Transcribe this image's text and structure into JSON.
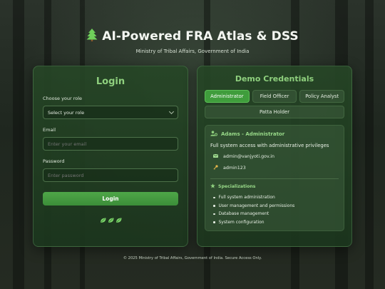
{
  "header": {
    "title": "AI-Powered FRA Atlas & DSS",
    "subtitle": "Ministry of Tribal Affairs, Government of India",
    "logo_icon": "tree-icon"
  },
  "login": {
    "title": "Login",
    "role_label": "Choose your role",
    "role_selected": "Select your role",
    "email_label": "Email",
    "email_placeholder": "Enter your email",
    "password_label": "Password",
    "password_placeholder": "Enter password",
    "submit_label": "Login"
  },
  "demo": {
    "title": "Demo Credentials",
    "roles": [
      {
        "label": "Administrator",
        "active": true
      },
      {
        "label": "Field Officer",
        "active": false
      },
      {
        "label": "Policy Analyst",
        "active": false
      },
      {
        "label": "Patta Holder",
        "active": false
      }
    ],
    "selected": {
      "name": "Adams - Administrator",
      "description": "Full system access with administrative privileges",
      "email": "admin@vanjyoti.gov.in",
      "password": "admin123",
      "specializations_title": "Specializations",
      "specializations": [
        "Full system administration",
        "User management and permissions",
        "Database management",
        "System configuration"
      ]
    }
  },
  "footer": {
    "text": "© 2025 Ministry of Tribal Affairs, Government of India. Secure Access Only."
  },
  "colors": {
    "accent": "#3f9d3c",
    "heading_green": "#8fd07e",
    "card_bg": "#244424"
  }
}
